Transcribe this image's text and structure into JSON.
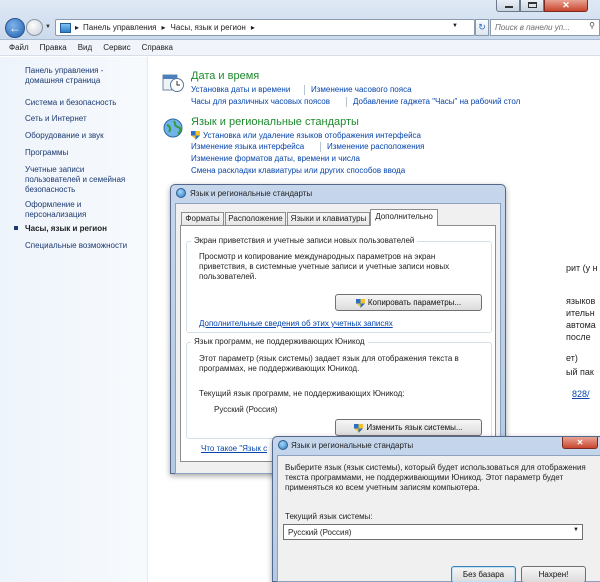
{
  "nav": {
    "breadcrumb": [
      "Панель управления",
      "Часы, язык и регион"
    ],
    "search_placeholder": "Поиск в панели уп..."
  },
  "menu": [
    "Файл",
    "Правка",
    "Вид",
    "Сервис",
    "Справка"
  ],
  "sidebar": {
    "items": [
      {
        "label": "Панель управления - домашняя страница"
      },
      {
        "label": "Система и безопасность"
      },
      {
        "label": "Сеть и Интернет"
      },
      {
        "label": "Оборудование и звук"
      },
      {
        "label": "Программы"
      },
      {
        "label": "Учетные записи пользователей и семейная безопасность"
      },
      {
        "label": "Оформление и персонализация"
      },
      {
        "label": "Часы, язык и регион"
      },
      {
        "label": "Специальные возможности"
      }
    ]
  },
  "main": {
    "datetime": {
      "title": "Дата и время",
      "links": [
        "Установка даты и времени",
        "Изменение часового пояса",
        "Часы для различных часовых поясов",
        "Добавление гаджета \"Часы\" на рабочий стол"
      ]
    },
    "regional": {
      "title": "Язык и региональные стандарты",
      "links": [
        "Установка или удаление языков отображения интерфейса",
        "Изменение языка интерфейса",
        "Изменение расположения",
        "Изменение форматов даты, времени и числа",
        "Смена раскладки клавиатуры или других способов ввода"
      ]
    }
  },
  "bg_fragments": [
    "рит (у н",
    "языков",
    "ительн",
    "автома",
    "после",
    "ет)",
    "ый пак",
    "828/"
  ],
  "dialog1": {
    "title": "Язык и региональные стандарты",
    "tabs": [
      "Форматы",
      "Расположение",
      "Языки и клавиатуры",
      "Дополнительно"
    ],
    "group1": {
      "label": "Экран приветствия и учетные записи новых пользователей",
      "text": "Просмотр и копирование международных параметров на экран приветствия, в системные учетные записи и учетные записи новых пользователей.",
      "button": "Копировать параметры...",
      "link": "Дополнительные сведения об этих учетных записях"
    },
    "group2": {
      "label": "Язык программ, не поддерживающих Юникод",
      "text": "Этот параметр (язык системы) задает язык для отображения текста в программах, не поддерживающих Юникод.",
      "current_label": "Текущий язык программ, не поддерживающих Юникод:",
      "current_value": "Русский (Россия)",
      "button": "Изменить язык системы..."
    },
    "bottom_link": "Что такое \"Язык с"
  },
  "dialog2": {
    "title": "Язык и региональные стандарты",
    "text": "Выберите язык (язык системы), который будет использоваться для отображения текста программами, не поддерживающими Юникод. Этот параметр будет применяться ко всем учетным записям компьютера.",
    "current_label": "Текущий язык системы:",
    "select_value": "Русский (Россия)",
    "ok": "Без базара",
    "cancel": "Нахрен!"
  }
}
